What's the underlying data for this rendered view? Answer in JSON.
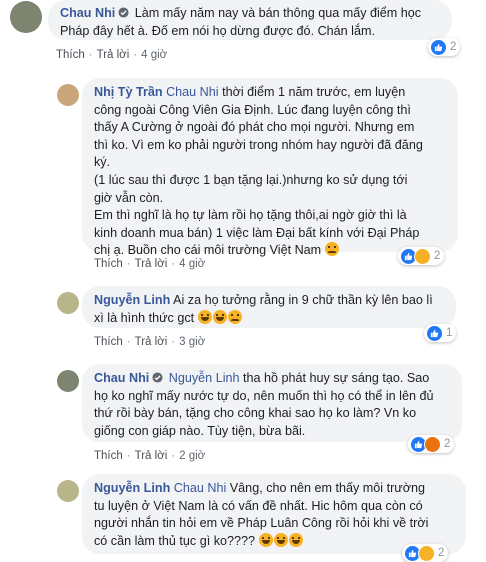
{
  "comments": [
    {
      "author": "Chau Nhi",
      "verified": true,
      "lines": [
        "Làm mấy năm nay và bán thông qua mấy điểm học",
        "Pháp đây hết à. Đố em nói họ dừng được đó. Chán lắm."
      ],
      "like_label": "Thích",
      "reply_label": "Trả lời",
      "time": "4 giờ",
      "reaction_count": "2"
    },
    {
      "author": "Nhị Tỳ Trần",
      "mention": "Chau Nhi",
      "lines_first": " thời điểm 1 năm trước, em luyện",
      "lines": [
        "công ngoài Công Viên Gia Định. Lúc đang luyện công thì",
        "thấy A Cường ở ngoài đó phát cho mọi người. Nhưng em",
        "thì ko. Vì em ko phải người trong nhóm hay người đã đăng",
        "ký.",
        "(1 lúc sau thì được 1 bạn tặng lại.)nhưng ko sử dụng tới",
        "giờ vẫn còn.",
        "Em thì nghĩ là họ tự làm rồi họ tặng thôi,ai ngờ giờ thì là",
        "kinh doanh mua bán) 1 việc làm Đại bất kính với Đại Pháp",
        "chị ạ. Buồn cho cái môi trường Việt Nam"
      ],
      "like_label": "Thích",
      "reply_label": "Trả lời",
      "time": "4 giờ",
      "reaction_count": "2"
    },
    {
      "author": "Nguyễn Linh",
      "lines_first": " Ai za họ tưởng rằng in 9 chữ thần kỳ lên bao lì",
      "lines": [
        "xì là hình thức gct"
      ],
      "like_label": "Thích",
      "reply_label": "Trả lời",
      "time": "3 giờ",
      "reaction_count": "1"
    },
    {
      "author": "Chau Nhi",
      "verified": true,
      "mention": "Nguyễn Linh",
      "lines_first": " tha hồ phát huy sự sáng tạo. Sao",
      "lines": [
        "họ ko nghĩ mấy nước tự do, nên muốn thì họ có thể in lên đủ",
        "thứ rồi bày bán, tặng cho công khai sao họ ko làm? Vn ko",
        "giống con giáp nào. Tùy tiện, bừa bãi."
      ],
      "like_label": "Thích",
      "reply_label": "Trả lời",
      "time": "2 giờ",
      "reaction_count": "2"
    },
    {
      "author": "Nguyễn Linh",
      "mention": "Chau Nhi",
      "lines_first": " Vâng, cho nên em thấy môi trường",
      "lines": [
        "tu luyện ở Việt Nam là có vấn đề nhất. Hic hôm qua còn có",
        "người nhắn tin hỏi em về Pháp Luân Công rồi hỏi khi về trời",
        "có cần làm thủ tục gì ko????"
      ],
      "reaction_count": "2"
    }
  ],
  "colors": {
    "name": "#385898",
    "bubble": "#f2f3f5",
    "like": "#2078f4",
    "emoji": "#f7b125"
  }
}
